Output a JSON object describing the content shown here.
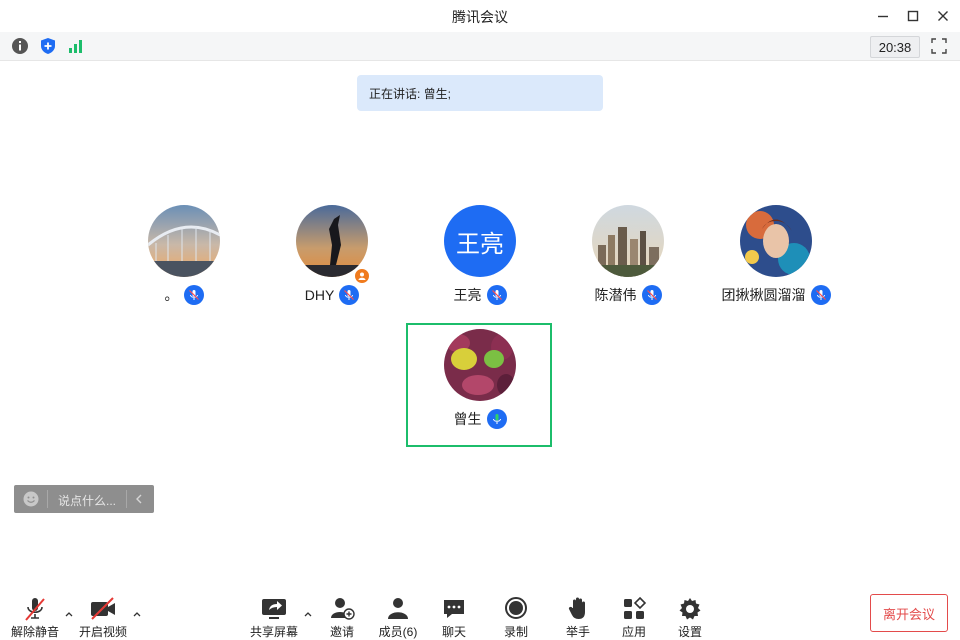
{
  "window": {
    "title": "腾讯会议",
    "controls": [
      "minimize-icon",
      "maximize-icon",
      "close-icon"
    ]
  },
  "status": {
    "icons": [
      "info-icon",
      "security-shield-icon",
      "signal-icon"
    ],
    "time": "20:38",
    "fullscreen_icon": "fullscreen-icon"
  },
  "speaking_banner": "正在讲话: 曾生;",
  "participants": [
    {
      "name": "。",
      "avatar": "bridge-photo",
      "mic": "muted"
    },
    {
      "name": "DHY",
      "avatar": "silhouette-photo",
      "mic": "muted",
      "host_badge": true
    },
    {
      "name": "王亮",
      "avatar_text": "王亮",
      "avatar_color": "#1e6cf3",
      "mic": "muted"
    },
    {
      "name": "陈潜伟",
      "avatar": "city-photo",
      "mic": "muted"
    },
    {
      "name": "团揪揪圆溜溜",
      "avatar": "art-portrait",
      "mic": "muted"
    },
    {
      "name": "曾生",
      "avatar": "leaves-photo",
      "mic": "speaking",
      "active": true
    }
  ],
  "chat": {
    "placeholder": "说点什么...",
    "emoji_icon": "emoji-icon",
    "collapse_icon": "chevron-left-icon"
  },
  "toolbar": {
    "unmute": "解除静音",
    "start_video": "开启视频",
    "share_screen": "共享屏幕",
    "invite": "邀请",
    "members": "成员(6)",
    "chat": "聊天",
    "record": "录制",
    "raise_hand": "举手",
    "apps": "应用",
    "settings": "设置",
    "leave": "离开会议"
  },
  "colors": {
    "accent": "#1e6cf3",
    "speaking_border": "#1cbd6b",
    "leave": "#e34b4b",
    "banner": "#dbe9fb"
  }
}
